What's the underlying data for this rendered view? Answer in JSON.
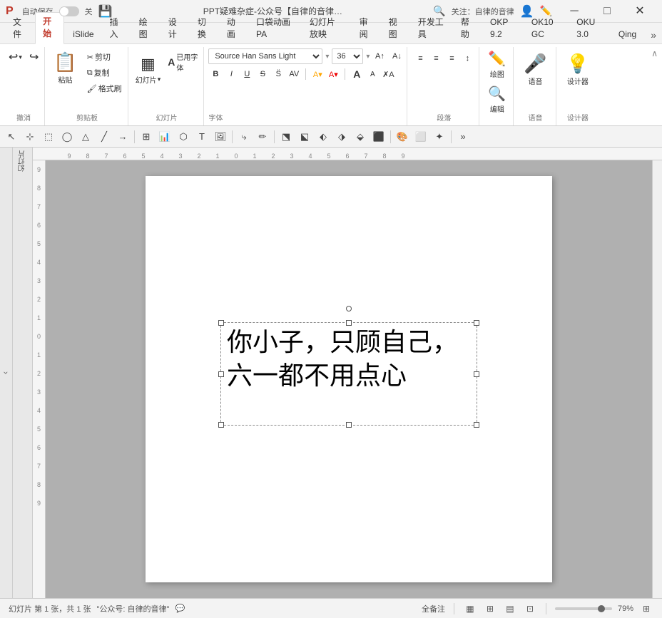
{
  "titlebar": {
    "logo": "P",
    "autosave_label": "自动保存",
    "toggle_state": "关",
    "save_icon": "💾",
    "title": "PPT疑难杂症-公众号【自律的音律…",
    "search_placeholder": "搜索",
    "follow_label": "关注：自律的音律",
    "user_icon": "👤",
    "pen_icon": "✏️"
  },
  "ribbon_tabs": {
    "active": "开始",
    "tabs": [
      "文件",
      "开始",
      "iSlide",
      "插入",
      "绘图",
      "设计",
      "切换",
      "动画",
      "口袋动画 PA",
      "幻灯片放映",
      "审阅",
      "视图",
      "开发工具",
      "帮助",
      "OKP 9.2",
      "OK10 GC",
      "OKU 3.0",
      "Qing"
    ]
  },
  "ribbon": {
    "undo_label": "撤消",
    "clipboard_label": "剪贴板",
    "slides_label": "幻灯片",
    "font_label": "字体",
    "paragraph_label": "段落",
    "draw_label": "绘图",
    "edit_label": "编辑",
    "voice_label": "语音",
    "designer_label": "设计器",
    "paste_label": "粘贴",
    "slides_btn_label": "幻灯片",
    "used_font_label": "已用字\n体",
    "undo_icon": "↩",
    "redo_icon": "↪",
    "paste_icon": "📋",
    "cut_icon": "✂",
    "copy_icon": "⧉",
    "format_paint_icon": "🖌",
    "slides_icon": "▦",
    "used_font_icon": "A",
    "font_name": "Source Han Sans Light",
    "font_size": "36",
    "bold_label": "B",
    "italic_label": "I",
    "underline_label": "U",
    "strikethrough_label": "S",
    "paragraph_icon": "≡",
    "draw_icon": "✏",
    "edit_icon": "🔍",
    "voice_icon": "🎤",
    "design_icon": "💡",
    "font_size_increase": "A↑",
    "font_size_decrease": "A↓",
    "font_color_label": "A",
    "highlight_label": "A",
    "char_spacing_label": "AV",
    "clear_format_label": "✗A"
  },
  "shapes_toolbar": {
    "shapes": [
      "⬚",
      "⬜",
      "⬡",
      "◯",
      "△",
      "⬟",
      "⬕",
      "⬔",
      "⬙",
      "⯃",
      "⬿",
      "⭆",
      "⬰",
      "|",
      "—",
      "⬅",
      "⬆",
      "⬇",
      "⬈",
      "⊞",
      "⊟",
      "⊠",
      "⊡",
      "⬛",
      "⬜",
      "⬤",
      "◈",
      "⬦",
      "⭘",
      "⬡",
      "⊕",
      "⊗",
      "|",
      "⬚",
      "⊞",
      "⭔",
      "⭓",
      "⬟",
      "⭕",
      "⊛",
      "|",
      "⬔",
      "⬕",
      "⬖",
      "⬗",
      "⬙",
      "⬛"
    ]
  },
  "slide": {
    "text_line1": "你小子，只顾自己，",
    "text_line2": "六一都不用点心",
    "font_family": "Source Sans Light",
    "font_size_display": "36"
  },
  "statusbar": {
    "slide_info": "幻灯片 第 1 张，共 1 张",
    "notes_label": "\"公众号: 自律的音律\"",
    "comment_icon": "🗪",
    "all_notes": "全备注",
    "view_normal": "▦",
    "view_grid": "⊞",
    "view_slide": "▤",
    "view_reader": "⊡",
    "zoom_percent": "79%",
    "zoom_fit": "⊞"
  },
  "ruler": {
    "h_marks": [
      "9",
      "8",
      "7",
      "6",
      "5",
      "4",
      "3",
      "2",
      "1",
      "0",
      "1",
      "2",
      "3",
      "4",
      "5",
      "6",
      "7",
      "8",
      "9"
    ],
    "v_marks": [
      "9",
      "8",
      "7",
      "6",
      "5",
      "4",
      "3",
      "2",
      "1",
      "0",
      "1",
      "2",
      "3",
      "4",
      "5",
      "6",
      "7",
      "8",
      "9"
    ]
  }
}
